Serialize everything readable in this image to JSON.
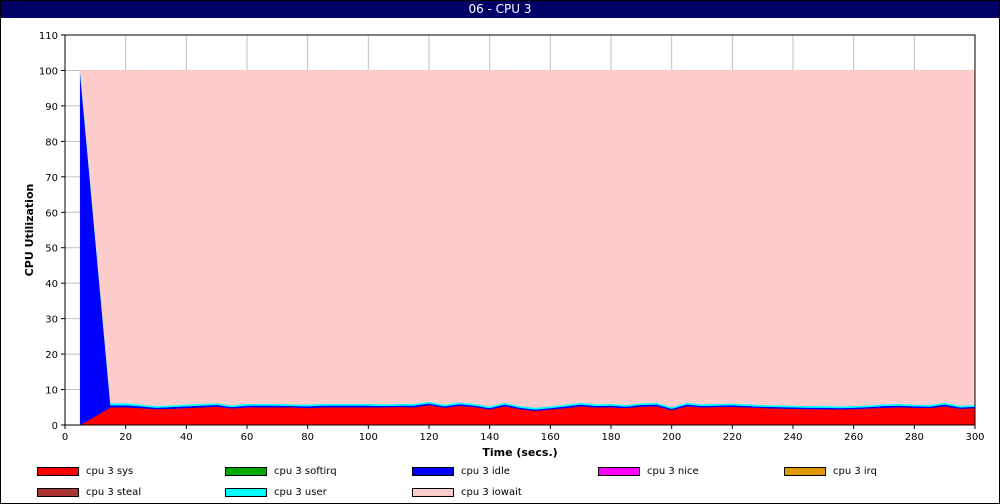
{
  "window": {
    "title": "06 - CPU 3"
  },
  "chart_data": {
    "type": "area",
    "stacked": true,
    "title": "06 - CPU 3",
    "xlabel": "Time (secs.)",
    "ylabel": "CPU Utilization",
    "xlim": [
      0,
      300
    ],
    "ylim": [
      0,
      110
    ],
    "xticks": [
      0,
      20,
      40,
      60,
      80,
      100,
      120,
      140,
      160,
      180,
      200,
      220,
      240,
      260,
      280,
      300
    ],
    "yticks": [
      0,
      10,
      20,
      30,
      40,
      50,
      60,
      70,
      80,
      90,
      100,
      110
    ],
    "grid": true,
    "legend_position": "bottom",
    "x": [
      5,
      15,
      20,
      25,
      30,
      35,
      40,
      45,
      50,
      55,
      60,
      65,
      70,
      75,
      80,
      85,
      90,
      95,
      100,
      105,
      110,
      115,
      120,
      125,
      130,
      135,
      140,
      145,
      150,
      155,
      160,
      165,
      170,
      175,
      180,
      185,
      190,
      195,
      200,
      205,
      210,
      215,
      220,
      225,
      230,
      235,
      240,
      245,
      250,
      255,
      260,
      265,
      270,
      275,
      280,
      285,
      290,
      295,
      300
    ],
    "series": [
      {
        "name": "cpu 3 sys",
        "color": "#ff0000",
        "values": [
          0,
          5,
          5,
          4.8,
          4.5,
          4.6,
          4.8,
          5,
          5.2,
          4.7,
          5,
          5,
          5,
          5,
          4.8,
          5,
          5,
          5,
          5,
          5,
          5.1,
          5,
          5.6,
          4.9,
          5.4,
          5.1,
          4.4,
          5.3,
          4.5,
          4,
          4.4,
          4.8,
          5.3,
          5,
          5,
          4.8,
          5.2,
          5.3,
          4.2,
          5.3,
          5,
          5.1,
          5.1,
          5,
          4.8,
          4.7,
          4.6,
          4.5,
          4.5,
          4.4,
          4.5,
          4.7,
          4.9,
          5,
          4.9,
          4.8,
          5.3,
          4.6,
          4.8
        ]
      },
      {
        "name": "cpu 3 softirq",
        "color": "#00aa00",
        "values": [
          0,
          0,
          0,
          0,
          0,
          0,
          0,
          0,
          0,
          0,
          0,
          0,
          0,
          0,
          0,
          0,
          0,
          0,
          0,
          0,
          0,
          0,
          0,
          0,
          0,
          0,
          0,
          0,
          0,
          0,
          0,
          0,
          0,
          0,
          0,
          0,
          0,
          0,
          0,
          0,
          0,
          0,
          0,
          0,
          0,
          0,
          0,
          0,
          0,
          0,
          0,
          0,
          0,
          0,
          0,
          0,
          0,
          0,
          0
        ]
      },
      {
        "name": "cpu 3 idle",
        "color": "#0000ff",
        "values": [
          99.3,
          0.6,
          0.6,
          0.5,
          0.4,
          0.5,
          0.5,
          0.5,
          0.5,
          0.4,
          0.5,
          0.5,
          0.5,
          0.4,
          0.5,
          0.5,
          0.5,
          0.5,
          0.5,
          0.4,
          0.4,
          0.5,
          0.5,
          0.4,
          0.5,
          0.4,
          0.4,
          0.5,
          0.4,
          0.4,
          0.4,
          0.5,
          0.5,
          0.4,
          0.5,
          0.4,
          0.5,
          0.5,
          0.4,
          0.5,
          0.4,
          0.4,
          0.5,
          0.4,
          0.4,
          0.4,
          0.4,
          0.4,
          0.4,
          0.4,
          0.4,
          0.4,
          0.5,
          0.5,
          0.4,
          0.4,
          0.5,
          0.4,
          0.4
        ]
      },
      {
        "name": "cpu 3 nice",
        "color": "#ff00ff",
        "values": [
          0,
          0,
          0,
          0,
          0,
          0,
          0,
          0,
          0,
          0,
          0,
          0,
          0,
          0,
          0,
          0,
          0,
          0,
          0,
          0,
          0,
          0,
          0,
          0,
          0,
          0,
          0,
          0,
          0,
          0,
          0,
          0,
          0,
          0,
          0,
          0,
          0,
          0,
          0,
          0,
          0,
          0,
          0,
          0,
          0,
          0,
          0,
          0,
          0,
          0,
          0,
          0,
          0,
          0,
          0,
          0,
          0,
          0,
          0
        ]
      },
      {
        "name": "cpu 3 irq",
        "color": "#e09900",
        "values": [
          0,
          0,
          0,
          0,
          0,
          0,
          0,
          0,
          0,
          0,
          0,
          0,
          0,
          0,
          0,
          0,
          0,
          0,
          0,
          0,
          0,
          0,
          0,
          0,
          0,
          0,
          0,
          0,
          0,
          0,
          0,
          0,
          0,
          0,
          0,
          0,
          0,
          0,
          0,
          0,
          0,
          0,
          0,
          0,
          0,
          0,
          0,
          0,
          0,
          0,
          0,
          0,
          0,
          0,
          0,
          0,
          0,
          0,
          0
        ]
      },
      {
        "name": "cpu 3 steal",
        "color": "#aa3333",
        "values": [
          0,
          0,
          0,
          0,
          0,
          0,
          0,
          0,
          0,
          0,
          0,
          0,
          0,
          0,
          0,
          0,
          0,
          0,
          0,
          0,
          0,
          0,
          0,
          0,
          0,
          0,
          0,
          0,
          0,
          0,
          0,
          0,
          0,
          0,
          0,
          0,
          0,
          0,
          0,
          0,
          0,
          0,
          0,
          0,
          0,
          0,
          0,
          0,
          0,
          0,
          0,
          0,
          0,
          0,
          0,
          0,
          0,
          0,
          0
        ]
      },
      {
        "name": "cpu 3 user",
        "color": "#00ffff",
        "values": [
          0.7,
          0.6,
          0.6,
          0.5,
          0.5,
          0.5,
          0.5,
          0.5,
          0.5,
          0.5,
          0.5,
          0.5,
          0.5,
          0.5,
          0.5,
          0.5,
          0.5,
          0.5,
          0.5,
          0.5,
          0.5,
          0.5,
          0.5,
          0.5,
          0.5,
          0.5,
          0.5,
          0.5,
          0.5,
          0.5,
          0.5,
          0.5,
          0.5,
          0.5,
          0.5,
          0.5,
          0.5,
          0.5,
          0.5,
          0.5,
          0.5,
          0.5,
          0.5,
          0.5,
          0.5,
          0.5,
          0.5,
          0.5,
          0.5,
          0.5,
          0.5,
          0.5,
          0.5,
          0.5,
          0.5,
          0.5,
          0.5,
          0.5,
          0.5
        ]
      },
      {
        "name": "cpu 3 iowait",
        "color": "#ffcccc",
        "values": [
          0,
          93.8,
          93.8,
          94.2,
          94.6,
          94.4,
          94.2,
          94,
          93.8,
          94.4,
          94,
          94,
          94,
          94.1,
          94.2,
          94,
          94,
          94,
          94,
          94.1,
          94,
          94,
          93.4,
          94.2,
          93.6,
          94,
          94.7,
          93.7,
          94.6,
          95.1,
          94.7,
          94.2,
          93.7,
          94.1,
          94,
          94.3,
          93.8,
          93.7,
          94.9,
          93.7,
          94.1,
          94,
          93.9,
          94.1,
          94.3,
          94.4,
          94.5,
          94.6,
          94.6,
          94.7,
          94.6,
          94.4,
          94.1,
          94,
          94.2,
          94.3,
          93.7,
          94.5,
          94.3
        ]
      }
    ]
  }
}
